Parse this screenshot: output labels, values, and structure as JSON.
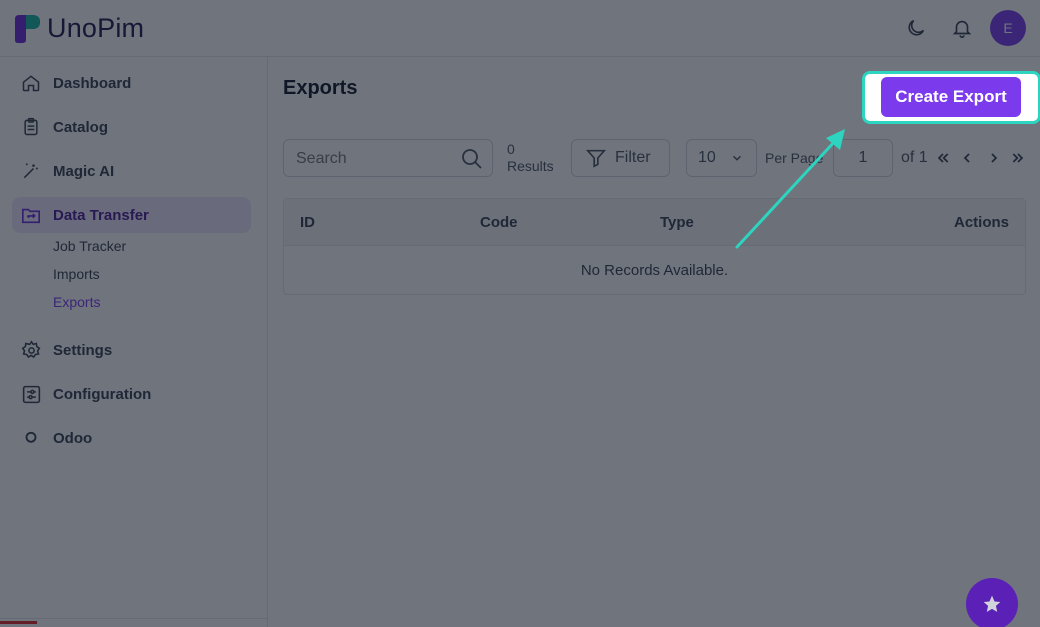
{
  "app": {
    "brand": "UnoPim",
    "avatar_initial": "E",
    "accent_color": "#7c3aed",
    "highlight_color": "#2dd4bf"
  },
  "header": {
    "icons": [
      "moon-icon",
      "bell-icon"
    ]
  },
  "sidebar": {
    "items": [
      {
        "label": "Dashboard",
        "icon": "home-icon"
      },
      {
        "label": "Catalog",
        "icon": "clipboard-icon"
      },
      {
        "label": "Magic AI",
        "icon": "magic-wand-icon"
      },
      {
        "label": "Data Transfer",
        "icon": "transfer-icon",
        "active": true
      },
      {
        "label": "Settings",
        "icon": "gear-icon"
      },
      {
        "label": "Configuration",
        "icon": "sliders-icon"
      },
      {
        "label": "Odoo",
        "icon": "circle-icon"
      }
    ],
    "subitems": [
      {
        "label": "Job Tracker"
      },
      {
        "label": "Imports"
      },
      {
        "label": "Exports",
        "active": true
      }
    ]
  },
  "main": {
    "title": "Exports",
    "create_button": "Create Export",
    "search_placeholder": "Search",
    "results_count": "0",
    "results_label": "Results",
    "filter_label": "Filter",
    "per_page_value": "10",
    "per_page_label": "Per Page",
    "page_value": "1",
    "of_label": "of 1",
    "table": {
      "columns": [
        "ID",
        "Code",
        "Type",
        "Actions"
      ],
      "empty_text": "No Records Available."
    }
  }
}
